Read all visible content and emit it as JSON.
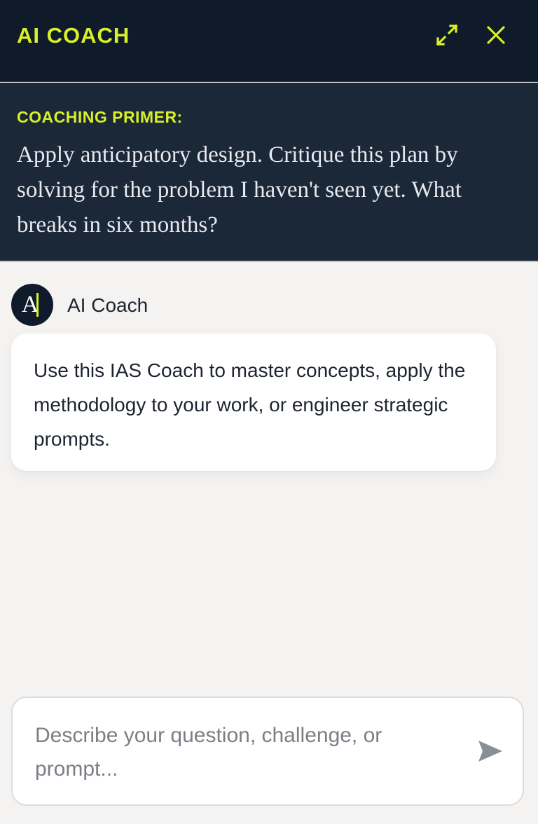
{
  "header": {
    "title": "AI COACH",
    "accent_color": "#d8f02a",
    "expand_icon": "expand-arrows-icon",
    "close_icon": "close-x-icon"
  },
  "primer": {
    "label": "COACHING PRIMER:",
    "text": "Apply anticipatory design. Critique this plan by solving for the problem I haven't seen yet. What breaks in six months?"
  },
  "conversation": {
    "messages": [
      {
        "sender": "AI Coach",
        "avatar_letter": "A",
        "text": "Use this IAS Coach to master concepts, apply the methodology to your work, or engineer strategic prompts."
      }
    ]
  },
  "composer": {
    "placeholder": "Describe your question, challenge, or prompt...",
    "value": "",
    "send_icon": "send-icon"
  }
}
